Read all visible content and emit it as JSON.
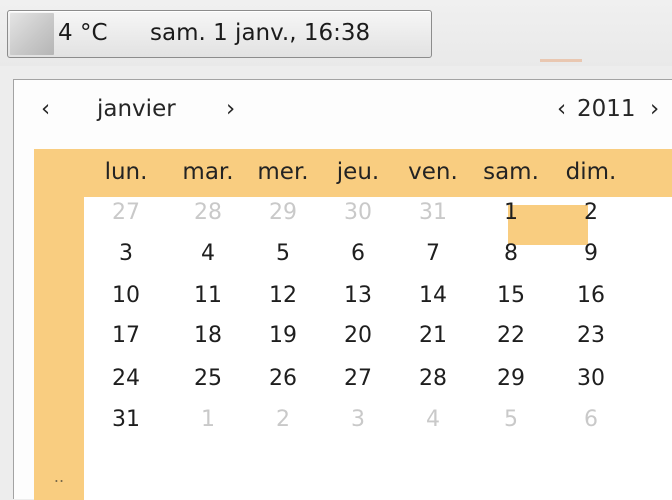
{
  "panel": {
    "temperature": "4 °C",
    "datetime": "sam.  1 janv., 16:38"
  },
  "calendar": {
    "nav": {
      "prev": "‹",
      "month": "janvier",
      "next": "›",
      "year_prev": "‹",
      "year": "2011",
      "year_next": "›"
    },
    "week_marker": "..",
    "weekdays": [
      "lun.",
      "mar.",
      "mer.",
      "jeu.",
      "ven.",
      "sam.",
      "dim."
    ],
    "weeks": [
      [
        "27",
        "28",
        "29",
        "30",
        "31",
        "1",
        "2"
      ],
      [
        "3",
        "4",
        "5",
        "6",
        "7",
        "8",
        "9"
      ],
      [
        "10",
        "11",
        "12",
        "13",
        "14",
        "15",
        "16"
      ],
      [
        "17",
        "18",
        "19",
        "20",
        "21",
        "22",
        "23"
      ],
      [
        "24",
        "25",
        "26",
        "27",
        "28",
        "29",
        "30"
      ],
      [
        "31",
        "1",
        "2",
        "3",
        "4",
        "5",
        "6"
      ]
    ],
    "selected_day": "1"
  },
  "colors": {
    "highlight": "#f9cd80",
    "dimmed_day": "#c9c9c9"
  }
}
